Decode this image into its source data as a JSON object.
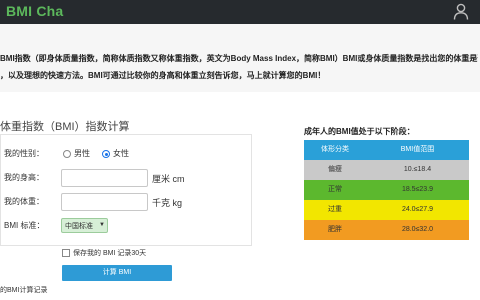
{
  "header": {
    "logo": "BMI Cha",
    "user_icon": "user-icon"
  },
  "intro": {
    "line1": "BMI指数（即身体质量指数，简称体质指数又称体重指数，英文为Body Mass Index，简称BMI）BMI或身体质量指数是找出您的体重是否超",
    "line2": "，以及理想的快速方法。BMI可通过比较你的身高和体重立刻告诉您，马上就计算您的BMI！"
  },
  "calculator": {
    "title": "体重指数（BMI）指数计算",
    "gender_label": "我的性别：",
    "gender_male": "男性",
    "gender_female": "女性",
    "gender_selected": "female",
    "height_label": "我的身高：",
    "height_value": "",
    "height_unit": "厘米 cm",
    "weight_label": "我的体重：",
    "weight_value": "",
    "weight_unit": "千克 kg",
    "standard_label": "BMI 标准：",
    "standard_value": "中国标准",
    "save_label": "保存我的 BMI 记录30天",
    "save_checked": false,
    "button": "计算 BMI",
    "history": "的BMI计算记录"
  },
  "reference": {
    "title": "成年人的BMI值处于以下阶段：",
    "headers": [
      "体形分类",
      "BMI值范围"
    ],
    "rows": [
      {
        "category": "偏瘦",
        "range": "10.≤18.4",
        "color": "#c9c9c9"
      },
      {
        "category": "正常",
        "range": "18.5≤23.9",
        "color": "#5cb82e"
      },
      {
        "category": "过重",
        "range": "24.0≤27.9",
        "color": "#f2e600"
      },
      {
        "category": "肥胖",
        "range": "28.0≤32.0",
        "color": "#f29b21"
      }
    ]
  }
}
